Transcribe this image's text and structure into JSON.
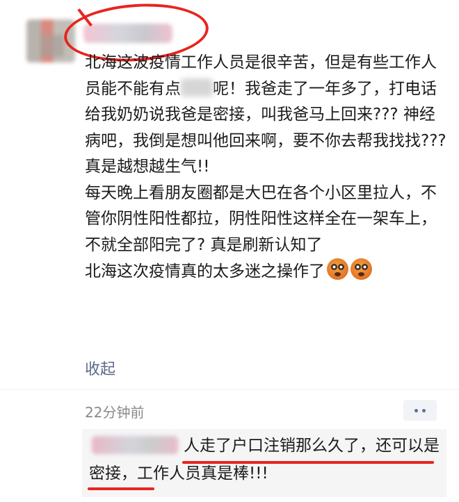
{
  "post": {
    "paragraphs": [
      {
        "before_redaction": "北海这波疫情工作人员是很辛苦，但是有些工作人员能不能有点",
        "after_redaction": "呢！我爸走了一年多了，打电话给我奶奶说我爸是密接，叫我爸马上回来??? 神经病吧，我倒是想叫他回来啊，要不你去帮我找找??? 真是越想越生气!!"
      },
      {
        "text": "每天晚上看朋友圈都是大巴在各个小区里拉人，不管你阴性阳性都拉，阴性阳性这样全在一架车上，不就全部阳完了? 真是刷新认知了"
      },
      {
        "text": "北海这次疫情真的太多迷之操作了"
      }
    ],
    "emoji_icons": [
      "astonished-face-icon",
      "astonished-face-icon"
    ],
    "collapse_label": "收起",
    "timestamp": "22分钟前"
  },
  "comment": {
    "text": "人走了户口注销那么久了，还可以是密接，工作人员真是棒!!!"
  },
  "colors": {
    "annotation_red": "#e8241f",
    "link_blue": "#5a6a8a",
    "comment_bg": "#f5f5f6"
  }
}
